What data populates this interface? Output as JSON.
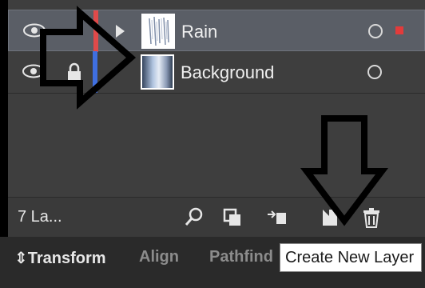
{
  "layers": [
    {
      "name": "Rain",
      "color": "#e04a4a",
      "selected": true
    },
    {
      "name": "Background",
      "color": "#3f6fe0",
      "selected": false
    }
  ],
  "footer": {
    "count_label": "7 La...",
    "icons": [
      "search-icon",
      "clipping-mask-icon",
      "move-to-layer-icon",
      "create-new-layer-icon",
      "trash-icon"
    ]
  },
  "tabs": [
    {
      "label": "Transform",
      "active": true
    },
    {
      "label": "Align",
      "active": false
    },
    {
      "label": "Pathfind",
      "active": false
    }
  ],
  "tabs_arrows_glyph": "⇕",
  "tooltip": {
    "text": "Create New Layer"
  },
  "colors": {
    "panel": "#3e3e3e",
    "selected_row": "#5a5e66",
    "selection_square": "#e23b3b"
  }
}
